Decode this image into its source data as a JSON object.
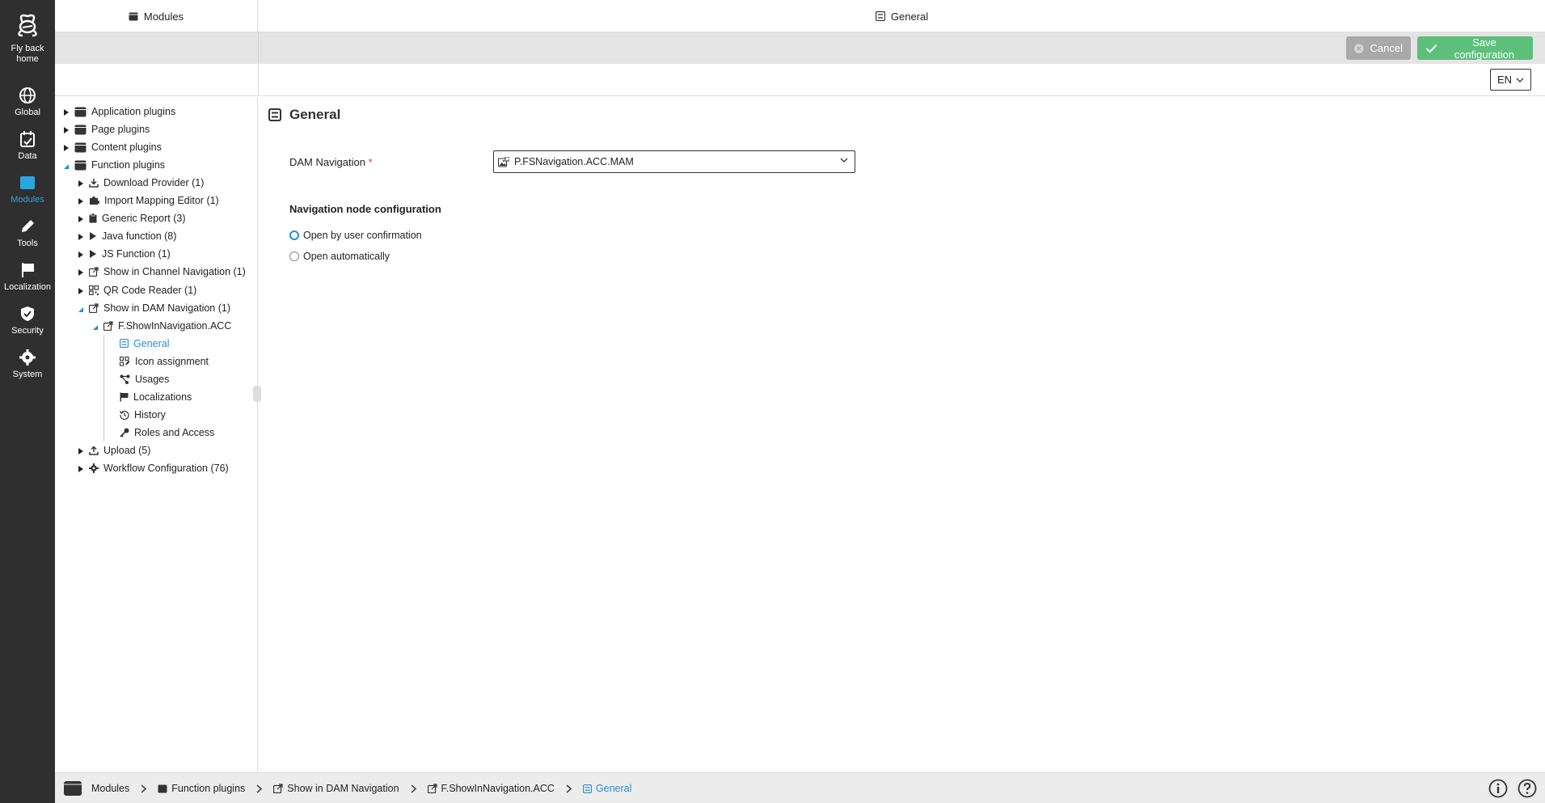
{
  "rail": {
    "home": "Fly back home",
    "items": [
      {
        "label": "Global",
        "icon": "globe-icon"
      },
      {
        "label": "Data",
        "icon": "data-icon"
      },
      {
        "label": "Modules",
        "icon": "modules-icon",
        "active": true
      },
      {
        "label": "Tools",
        "icon": "pencil-icon"
      },
      {
        "label": "Localization",
        "icon": "flag-icon"
      },
      {
        "label": "Security",
        "icon": "shield-icon"
      },
      {
        "label": "System",
        "icon": "gear-icon"
      }
    ]
  },
  "header": {
    "left_title": "Modules",
    "right_title": "General"
  },
  "toolbar": {
    "cancel_label": "Cancel",
    "save_label": "Save configuration"
  },
  "lang": {
    "value": "EN"
  },
  "tree": [
    {
      "label": "Application plugins",
      "level": 0,
      "state": "collapsed",
      "icon": "module-box-icon"
    },
    {
      "label": "Page plugins",
      "level": 0,
      "state": "collapsed",
      "icon": "module-box-icon"
    },
    {
      "label": "Content plugins",
      "level": 0,
      "state": "collapsed",
      "icon": "module-box-icon"
    },
    {
      "label": "Function plugins",
      "level": 0,
      "state": "expanded",
      "icon": "module-box-icon"
    },
    {
      "label": "Download Provider (1)",
      "level": 1,
      "state": "collapsed",
      "icon": "download-icon"
    },
    {
      "label": "Import Mapping Editor (1)",
      "level": 1,
      "state": "collapsed",
      "icon": "puzzle-icon"
    },
    {
      "label": "Generic Report (3)",
      "level": 1,
      "state": "collapsed",
      "icon": "clipboard-icon"
    },
    {
      "label": "Java function (8)",
      "level": 1,
      "state": "collapsed",
      "icon": "play-icon"
    },
    {
      "label": "JS Function (1)",
      "level": 1,
      "state": "collapsed",
      "icon": "play-icon"
    },
    {
      "label": "Show in Channel Navigation (1)",
      "level": 1,
      "state": "collapsed",
      "icon": "external-link-icon"
    },
    {
      "label": "QR Code Reader (1)",
      "level": 1,
      "state": "collapsed",
      "icon": "qr-icon"
    },
    {
      "label": "Show in DAM Navigation (1)",
      "level": 1,
      "state": "expanded",
      "icon": "external-link-icon"
    },
    {
      "label": "F.ShowInNavigation.ACC",
      "level": 2,
      "state": "expanded",
      "icon": "external-link-icon"
    },
    {
      "label": "General",
      "level": 3,
      "state": "leaf",
      "icon": "general-icon",
      "selected": true
    },
    {
      "label": "Icon assignment",
      "level": 3,
      "state": "leaf",
      "icon": "icon-assign-icon"
    },
    {
      "label": "Usages",
      "level": 3,
      "state": "leaf",
      "icon": "usages-icon"
    },
    {
      "label": "Localizations",
      "level": 3,
      "state": "leaf",
      "icon": "flag-icon"
    },
    {
      "label": "History",
      "level": 3,
      "state": "leaf",
      "icon": "history-icon"
    },
    {
      "label": "Roles and Access",
      "level": 3,
      "state": "leaf",
      "icon": "key-icon"
    },
    {
      "label": "Upload (5)",
      "level": 1,
      "state": "collapsed",
      "icon": "upload-icon"
    },
    {
      "label": "Workflow Configuration (76)",
      "level": 1,
      "state": "collapsed",
      "icon": "gear-icon"
    }
  ],
  "main": {
    "section_title": "General",
    "field_label": "DAM Navigation",
    "required_mark": "*",
    "select_value": "P.FSNavigation.ACC.MAM",
    "subsection_title": "Navigation node configuration",
    "radio_options": [
      {
        "label": "Open by user confirmation",
        "checked": true
      },
      {
        "label": "Open automatically",
        "checked": false
      }
    ]
  },
  "footer": {
    "crumbs": [
      "Modules",
      "Function plugins",
      "Show in DAM Navigation",
      "F.ShowInNavigation.ACC",
      "General"
    ]
  },
  "colors": {
    "rail_bg": "#2f2f2f",
    "accent": "#2a8fd0",
    "save_green": "#5cc07a",
    "cancel_gray": "#a9a9a9"
  }
}
